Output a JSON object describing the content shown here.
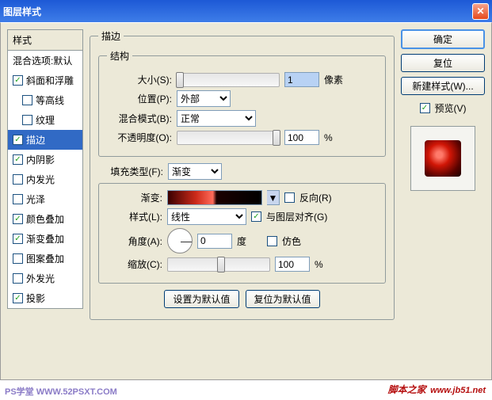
{
  "title": "图层样式",
  "styles_header": "样式",
  "blend_options": "混合选项:默认",
  "styles": [
    {
      "label": "斜面和浮雕",
      "checked": true,
      "indent": false
    },
    {
      "label": "等高线",
      "checked": false,
      "indent": true
    },
    {
      "label": "纹理",
      "checked": false,
      "indent": true
    },
    {
      "label": "描边",
      "checked": true,
      "indent": false,
      "selected": true
    },
    {
      "label": "内阴影",
      "checked": true,
      "indent": false
    },
    {
      "label": "内发光",
      "checked": false,
      "indent": false
    },
    {
      "label": "光泽",
      "checked": false,
      "indent": false
    },
    {
      "label": "颜色叠加",
      "checked": true,
      "indent": false
    },
    {
      "label": "渐变叠加",
      "checked": true,
      "indent": false
    },
    {
      "label": "图案叠加",
      "checked": false,
      "indent": false
    },
    {
      "label": "外发光",
      "checked": false,
      "indent": false
    },
    {
      "label": "投影",
      "checked": true,
      "indent": false
    }
  ],
  "stroke": {
    "legend_main": "描边",
    "legend_struct": "结构",
    "size_label": "大小(S):",
    "size_value": "1",
    "size_unit": "像素",
    "pos_label": "位置(P):",
    "pos_value": "外部",
    "blend_label": "混合模式(B):",
    "blend_value": "正常",
    "opacity_label": "不透明度(O):",
    "opacity_value": "100",
    "opacity_unit": "%",
    "filltype_label": "填充类型(F):",
    "filltype_value": "渐变",
    "grad_label": "渐变:",
    "reverse_label": "反向(R)",
    "style_label": "样式(L):",
    "style_value": "线性",
    "align_label": "与图层对齐(G)",
    "angle_label": "角度(A):",
    "angle_value": "0",
    "angle_unit": "度",
    "dither_label": "仿色",
    "scale_label": "缩放(C):",
    "scale_value": "100",
    "scale_unit": "%",
    "btn_default": "设置为默认值",
    "btn_reset": "复位为默认值"
  },
  "right": {
    "ok": "确定",
    "cancel": "复位",
    "new_style": "新建样式(W)...",
    "preview": "预览(V)"
  },
  "wm1": "PS学堂  WWW.52PSXT.COM",
  "wm2": "脚本之家",
  "wm2b": "www.jb51.net"
}
